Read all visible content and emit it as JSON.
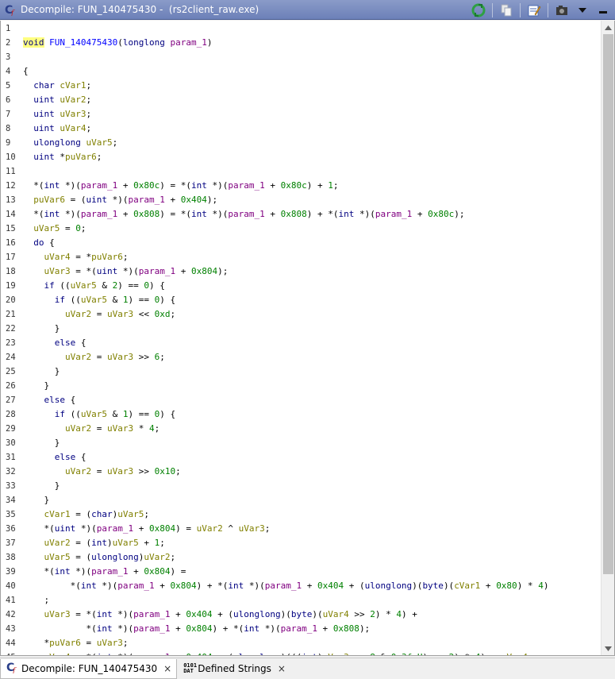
{
  "window": {
    "title": "Decompile: FUN_140475430 -  (rs2client_raw.exe)"
  },
  "toolbar": {
    "icons": [
      "refresh-icon",
      "copy-icon",
      "edit-icon",
      "snapshot-icon",
      "menu-chevron-icon",
      "minimize-icon"
    ]
  },
  "colors": {
    "keyword": "#000080",
    "function": "#0000ff",
    "param": "#800080",
    "local": "#808000",
    "number": "#008000"
  },
  "code": {
    "lines": [
      "1",
      "2",
      "3",
      "4",
      "5",
      "6",
      "7",
      "8",
      "9",
      "10",
      "11",
      "12",
      "13",
      "14",
      "15",
      "16",
      "17",
      "18",
      "19",
      "20",
      "21",
      "22",
      "23",
      "24",
      "25",
      "26",
      "27",
      "28",
      "29",
      "30",
      "31",
      "32",
      "33",
      "34",
      "35",
      "36",
      "37",
      "38",
      "39",
      "40",
      "41",
      "42",
      "43",
      "44",
      "45"
    ]
  },
  "tabs": [
    {
      "label": "Decompile: FUN_140475430",
      "close": "×"
    },
    {
      "label": "Defined Strings",
      "close": "×",
      "icon_text": "0101 DAT"
    }
  ]
}
